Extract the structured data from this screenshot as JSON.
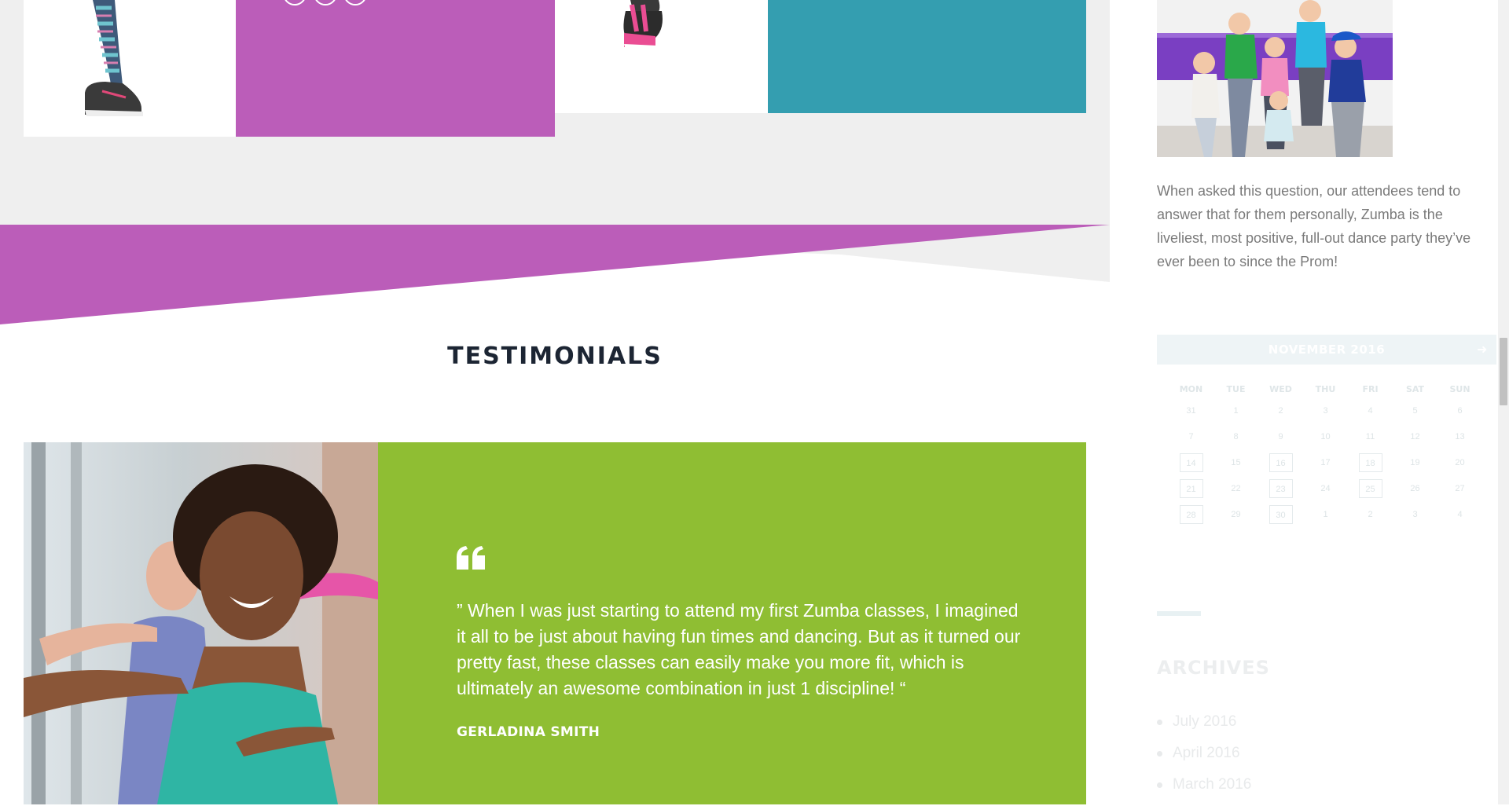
{
  "testimonials": {
    "section_title": "TESTIMONIALS",
    "quote": "” When I was just starting to attend my first Zumba classes, I imagined it all to be just about having fun times and dancing. But as it turned our pretty fast, these classes can easily make you more fit, which is ultimately an awesome combination in just 1 discipline! “",
    "author": "GERLADINA SMITH"
  },
  "sidebar": {
    "about_text": "When asked this question, our attendees tend to answer that for them personally, Zumba is the liveliest, most positive, full-out dance party they’ve ever been to since the Prom!",
    "calendar": {
      "month": "NOVEMBER 2016",
      "next_icon": "arrow-right-icon",
      "weekdays": [
        "MON",
        "TUE",
        "WED",
        "THU",
        "FRI",
        "SAT",
        "SUN"
      ],
      "weeks": [
        [
          {
            "d": "31"
          },
          {
            "d": "1"
          },
          {
            "d": "2"
          },
          {
            "d": "3"
          },
          {
            "d": "4"
          },
          {
            "d": "5"
          },
          {
            "d": "6"
          }
        ],
        [
          {
            "d": "7"
          },
          {
            "d": "8"
          },
          {
            "d": "9"
          },
          {
            "d": "10"
          },
          {
            "d": "11"
          },
          {
            "d": "12"
          },
          {
            "d": "13"
          }
        ],
        [
          {
            "d": "14",
            "event": true
          },
          {
            "d": "15"
          },
          {
            "d": "16",
            "event": true
          },
          {
            "d": "17"
          },
          {
            "d": "18",
            "event": true
          },
          {
            "d": "19"
          },
          {
            "d": "20"
          }
        ],
        [
          {
            "d": "21",
            "event": true
          },
          {
            "d": "22"
          },
          {
            "d": "23",
            "event": true
          },
          {
            "d": "24"
          },
          {
            "d": "25",
            "event": true
          },
          {
            "d": "26"
          },
          {
            "d": "27"
          }
        ],
        [
          {
            "d": "28",
            "event": true
          },
          {
            "d": "29"
          },
          {
            "d": "30",
            "event": true
          },
          {
            "d": "1"
          },
          {
            "d": "2"
          },
          {
            "d": "3"
          },
          {
            "d": "4"
          }
        ]
      ]
    },
    "archives": {
      "title": "ARCHIVES",
      "items": [
        "July 2016",
        "April 2016",
        "March 2016"
      ]
    }
  },
  "colors": {
    "purple": "#bb5db9",
    "teal": "#349eb0",
    "green": "#8fbe33",
    "heading": "#1c2533",
    "gray_band": "#efefef"
  }
}
